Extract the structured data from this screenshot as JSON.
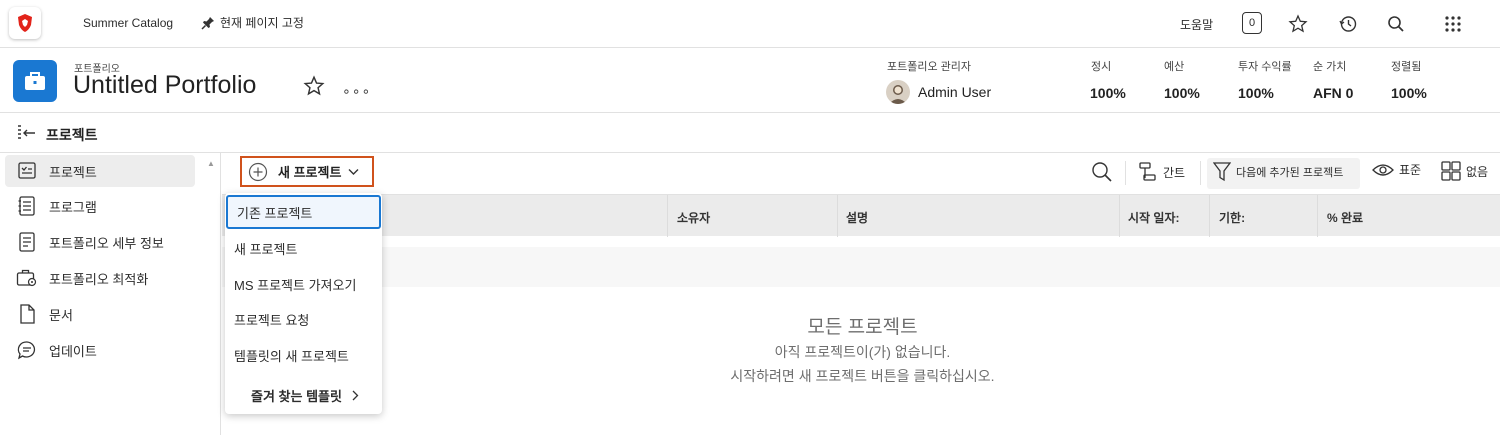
{
  "topbar": {
    "catalog_label": "Summer Catalog",
    "pin_label": "현재 페이지 고정",
    "help_label": "도움말",
    "notification_count": "0",
    "icons": [
      "brand-logo-icon",
      "pin-icon",
      "star-icon",
      "history-icon",
      "search-icon",
      "apps-grid-icon"
    ]
  },
  "header": {
    "kicker": "포트폴리오",
    "title": "Untitled Portfolio",
    "more_label": "∘∘∘",
    "manager_label": "포트폴리오 관리자",
    "manager_name": "Admin User",
    "stats": [
      {
        "label": "정시",
        "value": "100%"
      },
      {
        "label": "예산",
        "value": "100%"
      },
      {
        "label": "투자 수익률",
        "value": "100%"
      },
      {
        "label": "순 가치",
        "value": "AFN 0"
      },
      {
        "label": "정렬됨",
        "value": "100%"
      }
    ]
  },
  "section": {
    "title": "프로젝트"
  },
  "sidebar": {
    "items": [
      {
        "label": "프로젝트",
        "icon": "projects-icon",
        "active": true
      },
      {
        "label": "프로그램",
        "icon": "programs-icon"
      },
      {
        "label": "포트폴리오 세부 정보",
        "icon": "details-icon"
      },
      {
        "label": "포트폴리오 최적화",
        "icon": "optimize-icon"
      },
      {
        "label": "문서",
        "icon": "document-icon"
      },
      {
        "label": "업데이트",
        "icon": "updates-icon"
      }
    ]
  },
  "toolbar": {
    "new_project": "새 프로젝트",
    "gantt": "간트",
    "filter": "다음에 추가된 프로젝트",
    "view": "표준",
    "grouping": "없음"
  },
  "table": {
    "columns": [
      "소유자",
      "설명",
      "시작 일자:",
      "기한:",
      "% 완료"
    ]
  },
  "empty_state": {
    "title": "모든 프로젝트",
    "line1": "아직 프로젝트이(가) 없습니다.",
    "line2": "시작하려면 새 프로젝트 버튼을 클릭하십시오."
  },
  "dropdown": {
    "items": [
      "기존 프로젝트",
      "새 프로젝트",
      "MS 프로젝트 가져오기",
      "프로젝트 요청",
      "템플릿의 새 프로젝트"
    ],
    "submenu": "즐겨 찾는 템플릿"
  },
  "colors": {
    "accent": "#1a78d2",
    "highlight_border": "#d0521c",
    "brand": "#e2231a"
  }
}
